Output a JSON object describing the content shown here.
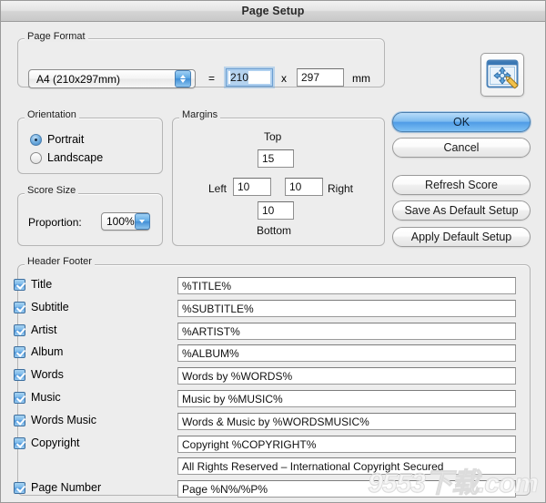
{
  "window": {
    "title": "Page Setup"
  },
  "page_format": {
    "group_label": "Page Format",
    "selected_format": "A4 (210x297mm)",
    "equals_sign": "=",
    "width_value": "210",
    "times_sign": "x",
    "height_value": "297",
    "unit": "mm"
  },
  "orientation": {
    "group_label": "Orientation",
    "options": [
      {
        "label": "Portrait",
        "selected": true
      },
      {
        "label": "Landscape",
        "selected": false
      }
    ]
  },
  "score_size": {
    "group_label": "Score Size",
    "proportion_label": "Proportion:",
    "proportion_value": "100%"
  },
  "margins": {
    "group_label": "Margins",
    "top_label": "Top",
    "top_value": "15",
    "left_label": "Left",
    "left_value": "10",
    "right_label": "Right",
    "right_value": "10",
    "bottom_label": "Bottom",
    "bottom_value": "10"
  },
  "buttons": {
    "ok": "OK",
    "cancel": "Cancel",
    "refresh_score": "Refresh Score",
    "save_as_default": "Save As Default Setup",
    "apply_default": "Apply Default Setup",
    "preview_icon": "page-preview-move-icon"
  },
  "header_footer": {
    "group_label": "Header  Footer",
    "rows": [
      {
        "has_checkbox": true,
        "checked": true,
        "label": "Title",
        "value": "%TITLE%"
      },
      {
        "has_checkbox": true,
        "checked": true,
        "label": "Subtitle",
        "value": "%SUBTITLE%"
      },
      {
        "has_checkbox": true,
        "checked": true,
        "label": "Artist",
        "value": "%ARTIST%"
      },
      {
        "has_checkbox": true,
        "checked": true,
        "label": "Album",
        "value": "%ALBUM%"
      },
      {
        "has_checkbox": true,
        "checked": true,
        "label": "Words",
        "value": "Words by %WORDS%"
      },
      {
        "has_checkbox": true,
        "checked": true,
        "label": "Music",
        "value": "Music by %MUSIC%"
      },
      {
        "has_checkbox": true,
        "checked": true,
        "label": "Words  Music",
        "value": "Words & Music by %WORDSMUSIC%"
      },
      {
        "has_checkbox": true,
        "checked": true,
        "label": "Copyright",
        "value": "Copyright %COPYRIGHT%"
      },
      {
        "has_checkbox": false,
        "checked": false,
        "label": "",
        "value": "All Rights Reserved – International Copyright Secured"
      },
      {
        "has_checkbox": true,
        "checked": true,
        "label": "Page Number",
        "value": "Page %N%/%P%"
      }
    ]
  },
  "watermark": {
    "text": "9553下载.com"
  },
  "colors": {
    "window_bg": "#ececec",
    "accent_blue": "#4f9ce6",
    "field_bg": "#ffffff",
    "border": "#b5b5b5"
  }
}
